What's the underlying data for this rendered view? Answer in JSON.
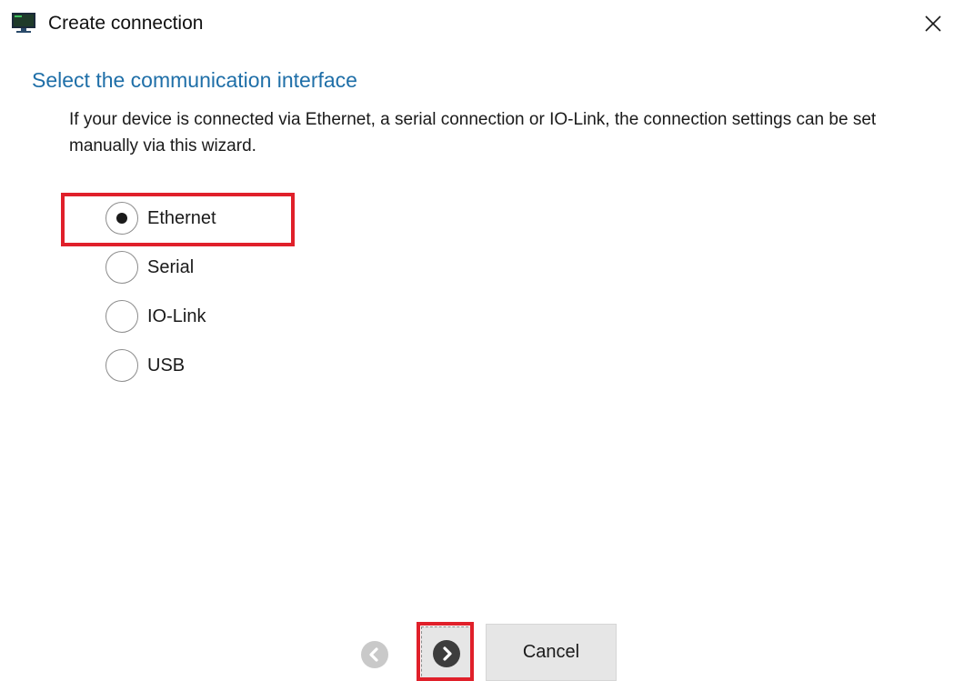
{
  "window": {
    "title": "Create connection",
    "app_icon": "monitor-icon",
    "close_icon": "close-icon"
  },
  "content": {
    "heading": "Select the communication interface",
    "description": "If your device  is connected via Ethernet, a serial connection or IO-Link, the connection settings can be set manually via this wizard."
  },
  "interfaces": {
    "selected": "Ethernet",
    "options": [
      "Ethernet",
      "Serial",
      "IO-Link",
      "USB"
    ]
  },
  "footer": {
    "back_icon": "chevron-left-icon",
    "back_enabled": false,
    "next_icon": "chevron-right-icon",
    "next_enabled": true,
    "cancel_label": "Cancel"
  },
  "colors": {
    "heading": "#1f6fa8",
    "highlight": "#e0202a",
    "button_bg": "#e6e6e6"
  }
}
